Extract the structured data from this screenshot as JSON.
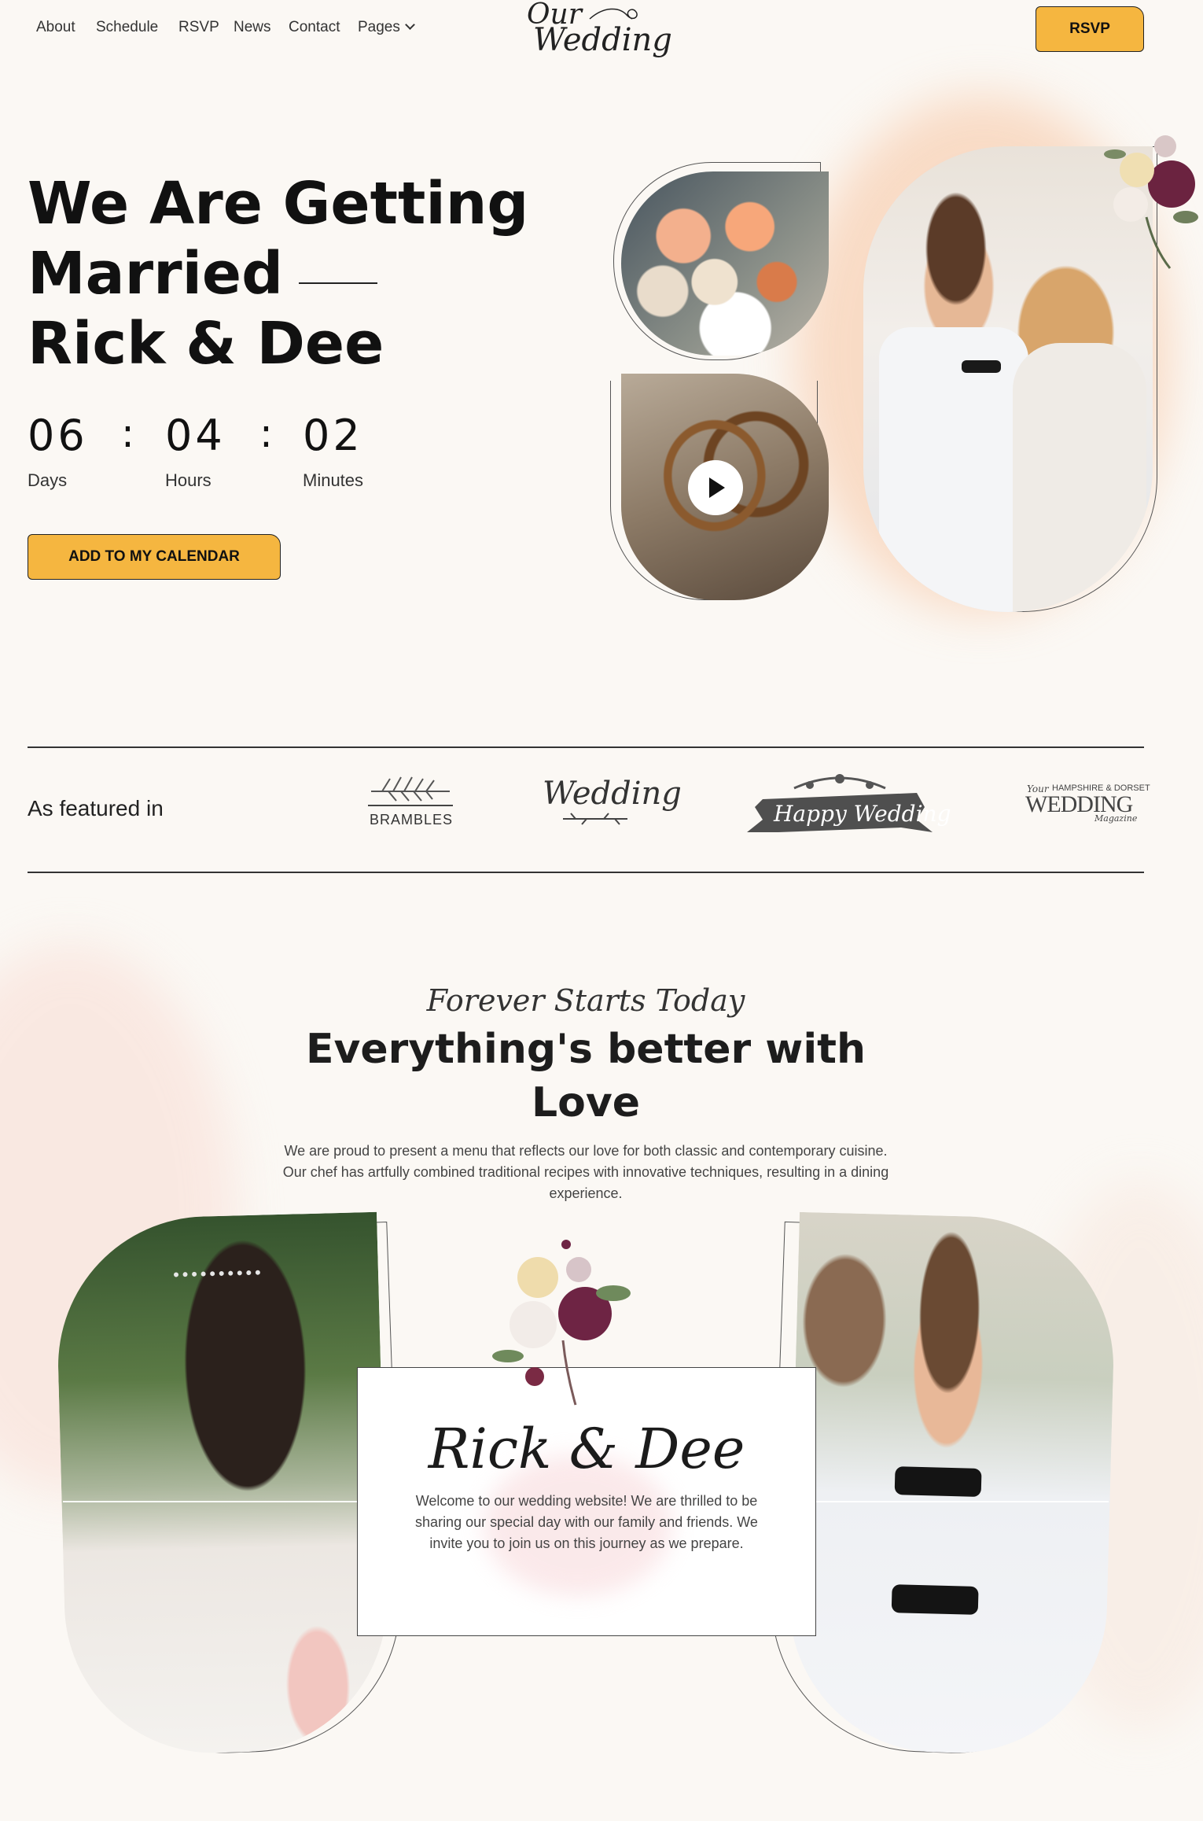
{
  "nav": {
    "links": [
      "About",
      "Schedule",
      "RSVP",
      "News",
      "Contact"
    ],
    "pages_label": "Pages",
    "logo_line1": "Our",
    "logo_line2": "Wedding",
    "rsvp_button": "RSVP"
  },
  "hero": {
    "title_line1": "We Are Getting",
    "title_line2": "Married",
    "title_line3": "Rick & Dee",
    "countdown": [
      {
        "value": "06",
        "label": "Days"
      },
      {
        "value": "04",
        "label": "Hours"
      },
      {
        "value": "02",
        "label": "Minutes"
      }
    ],
    "separator": ":",
    "calendar_button": "ADD TO MY CALENDAR"
  },
  "featured": {
    "label": "As featured in",
    "logos": {
      "brambles": "BRAMBLES",
      "wedding": "Wedding",
      "happy_wedding": "Happy Wedding",
      "magazine_top": "HAMPSHIRE & DORSET",
      "magazine_your": "Your",
      "magazine_main": "WEDDING",
      "magazine_sub": "Magazine"
    }
  },
  "love": {
    "script_heading": "Forever Starts Today",
    "title_line1": "Everything's better with",
    "title_line2": "Love",
    "text": "We are proud to present a menu that reflects our love for both classic and contemporary cuisine. Our chef has artfully combined traditional recipes with innovative techniques, resulting in a dining experience.",
    "card_name": "Rick & Dee",
    "card_text": "Welcome to our wedding website! We are thrilled to be sharing our special day with our family and friends. We invite you to join us on this journey as we prepare."
  },
  "colors": {
    "accent": "#f5b640",
    "background": "#fbf8f4",
    "text": "#111111",
    "watercolor": "#f6c9a8"
  }
}
